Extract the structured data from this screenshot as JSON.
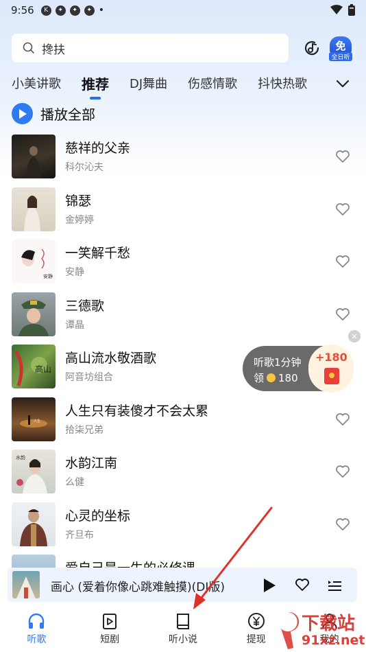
{
  "status_bar": {
    "time": "9:56",
    "icons": [
      "k-icon",
      "pinwheel-icon",
      "pinwheel-icon",
      "pinwheel-icon"
    ],
    "dot": "•"
  },
  "search": {
    "value": "搀扶"
  },
  "vip": {
    "badge": "免",
    "label": "全日听"
  },
  "tabs": [
    {
      "label": "小美讲歌",
      "active": false
    },
    {
      "label": "推荐",
      "active": true
    },
    {
      "label": "DJ舞曲",
      "active": false
    },
    {
      "label": "伤感情歌",
      "active": false
    },
    {
      "label": "抖快热歌",
      "active": false
    }
  ],
  "play_all": {
    "label": "播放全部"
  },
  "songs": [
    {
      "title": "慈祥的父亲",
      "artist": "科尔沁夫"
    },
    {
      "title": "锦瑟",
      "artist": "金婷婷"
    },
    {
      "title": "一笑解千愁",
      "artist": "安静"
    },
    {
      "title": "三德歌",
      "artist": "谭晶"
    },
    {
      "title": "高山流水敬酒歌",
      "artist": "阿音坊组合"
    },
    {
      "title": "人生只有装傻才不会太累",
      "artist": "拾柒兄弟"
    },
    {
      "title": "水韵江南",
      "artist": "么健"
    },
    {
      "title": "心灵的坐标",
      "artist": "齐旦布"
    },
    {
      "title": "爱自己是一生的必修课",
      "artist": ""
    }
  ],
  "reward": {
    "line1": "听歌1分钟",
    "line2_prefix": "领",
    "line2_amount": "180",
    "plus": "+180",
    "close": "×"
  },
  "mini_player": {
    "title": "画心 (爱着你像心跳难触摸)(DJ版)"
  },
  "bottom_nav": [
    {
      "label": "听歌",
      "icon": "headphones-icon",
      "active": true
    },
    {
      "label": "短剧",
      "icon": "play-square-icon",
      "active": false
    },
    {
      "label": "听小说",
      "icon": "book-icon",
      "active": false
    },
    {
      "label": "提现",
      "icon": "yuan-icon",
      "active": false
    },
    {
      "label": "我的",
      "icon": "user-icon",
      "active": false
    }
  ],
  "watermark": {
    "line1": "下载站",
    "line2": "91xz.net"
  },
  "colors": {
    "accent": "#2f7bf0",
    "arrow": "#e0302a"
  }
}
